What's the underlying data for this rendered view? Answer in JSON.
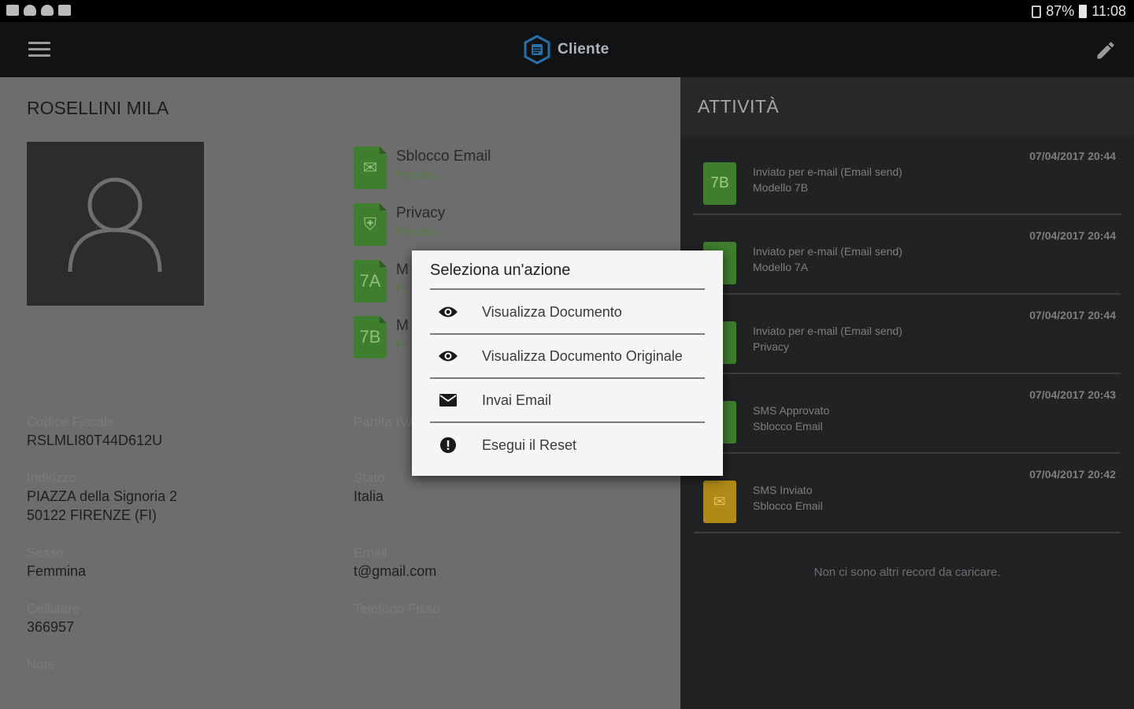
{
  "status_bar": {
    "battery": "87%",
    "time": "11:08"
  },
  "app_bar": {
    "title": "Cliente"
  },
  "client": {
    "name": "ROSELLINI MILA",
    "fields": {
      "codice_fiscale": {
        "label": "Codice Fiscale",
        "value": "RSLMLI80T44D612U"
      },
      "partita_iva": {
        "label": "Partita IVA",
        "value": ""
      },
      "indirizzo": {
        "label": "Indirizzo",
        "line1": "PIAZZA della Signoria 2",
        "line2": "50122 FIRENZE (FI)"
      },
      "stato": {
        "label": "Stato",
        "value": "Italia"
      },
      "sesso": {
        "label": "Sesso",
        "value": "Femmina"
      },
      "email": {
        "label": "Email",
        "value": "t@gmail.com"
      },
      "cellulare": {
        "label": "Cellulare",
        "value": "366957"
      },
      "telefono_fisso": {
        "label": "Telefono Fisso",
        "value": ""
      },
      "note": {
        "label": "Note",
        "value": ""
      }
    },
    "documents": [
      {
        "icon": "email-icon",
        "title": "Sblocco Email",
        "status": "Firmato"
      },
      {
        "icon": "shield-icon",
        "title": "Privacy",
        "status": "Firmato"
      },
      {
        "icon": "7A",
        "title": "M",
        "status": "Fi"
      },
      {
        "icon": "7B",
        "title": "M",
        "status": "Fi"
      }
    ]
  },
  "activity": {
    "title": "ATTIVITÀ",
    "items": [
      {
        "icon": "7B",
        "color": "green",
        "line1": "Inviato per e-mail (Email send)",
        "line2": "Modello 7B",
        "date": "07/04/2017 20:44"
      },
      {
        "icon": "",
        "color": "green",
        "line1": "Inviato per e-mail (Email send)",
        "line2": "Modello 7A",
        "date": "07/04/2017 20:44"
      },
      {
        "icon": "",
        "color": "green",
        "line1": "Inviato per e-mail (Email send)",
        "line2": "Privacy",
        "date": "07/04/2017 20:44"
      },
      {
        "icon": "",
        "color": "green",
        "line1": "SMS Approvato",
        "line2": "Sblocco Email",
        "date": "07/04/2017 20:43"
      },
      {
        "icon": "",
        "color": "yellow",
        "line1": "SMS Inviato",
        "line2": "Sblocco Email",
        "date": "07/04/2017 20:42"
      }
    ],
    "no_more": "Non ci sono altri record da caricare."
  },
  "dialog": {
    "title": "Seleziona un'azione",
    "items": [
      {
        "icon": "eye-icon",
        "label": "Visualizza Documento"
      },
      {
        "icon": "eye-icon",
        "label": "Visualizza Documento Originale"
      },
      {
        "icon": "envelope-icon",
        "label": "Invai Email"
      },
      {
        "icon": "alert-icon",
        "label": "Esegui il Reset"
      }
    ]
  },
  "colors": {
    "green": "#3f7e2e",
    "yellow": "#b08a16",
    "dark": "#212224",
    "dialog": "#f5f5f5"
  }
}
